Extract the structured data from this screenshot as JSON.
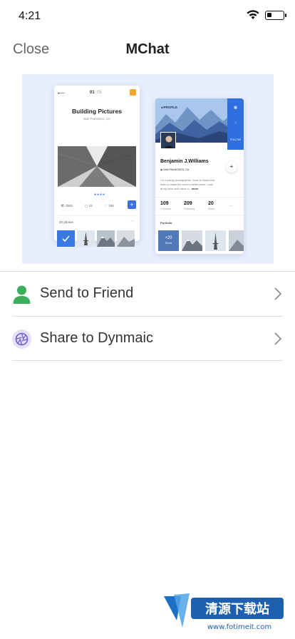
{
  "status_bar": {
    "time": "4:21"
  },
  "nav": {
    "close_label": "Close",
    "title": "MChat"
  },
  "preview": {
    "left_card": {
      "back": "⟵",
      "page_current": "01",
      "page_total": "05",
      "title": "Building Pictures",
      "subtitle": "San Francisco, CA",
      "stats": {
        "views": "3565",
        "comments": "15",
        "likes": "196"
      },
      "plus": "+",
      "photos_label": "20 photos",
      "more": "···"
    },
    "right_card": {
      "profile_label": "◂  PROFILE",
      "name": "Benjamin J.Williams",
      "location": "SAN FRANCISCO, CA",
      "bio": "I'm a young photographer, Juice to travel and learn to make the world a better place. Look at my work and check it... ",
      "bio_more": "more",
      "stats": [
        {
          "value": "109",
          "label": "Followers"
        },
        {
          "value": "209",
          "label": "Following"
        },
        {
          "value": "20",
          "label": "Shots"
        }
      ],
      "stats_more": "···",
      "portfolio_label": "Portfolio",
      "more_tile": {
        "count": "+20",
        "label": "Shots"
      },
      "plus": "+",
      "sidebar_button": "FOLLOW"
    }
  },
  "actions": [
    {
      "label": "Send to Friend"
    },
    {
      "label": "Share to Dynmaic"
    }
  ],
  "colors": {
    "send_icon": "#3cae5c",
    "share_icon_bg": "#e6e0fa",
    "share_icon": "#6a5bd6",
    "preview_bg": "#e8eefb",
    "accent_blue": "#2f6fe0"
  },
  "watermark": {
    "main": "清源下载站",
    "url": "www.fotimeit.com"
  }
}
